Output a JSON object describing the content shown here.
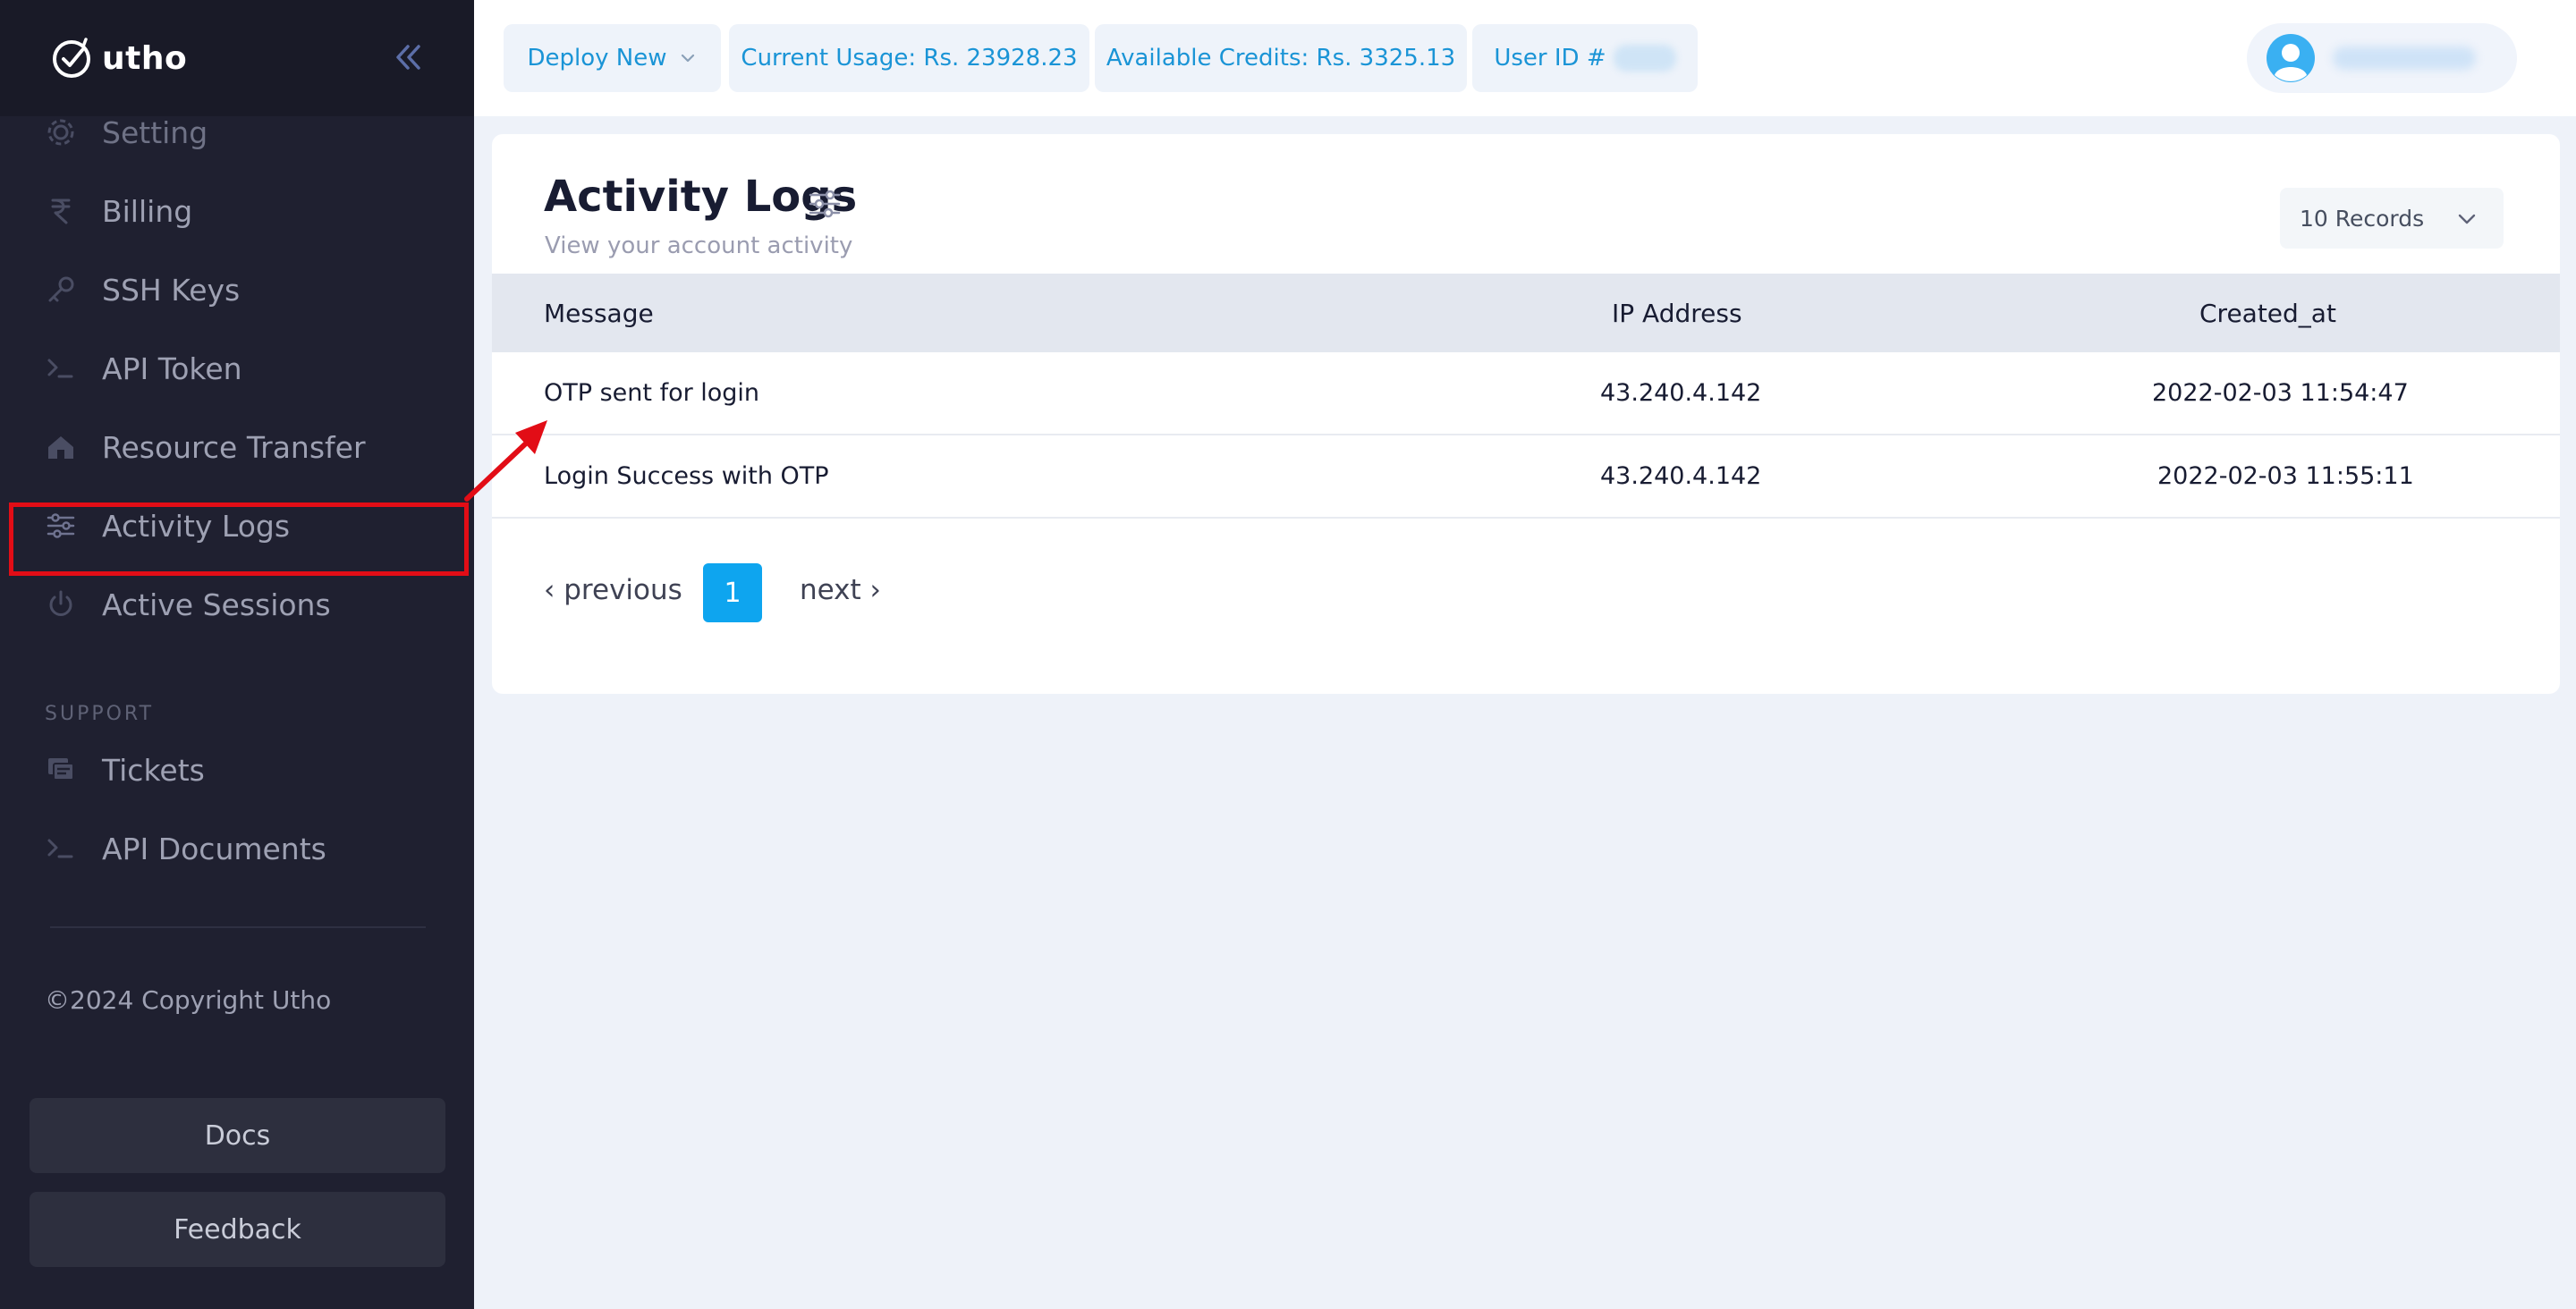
{
  "brand": {
    "name": "utho"
  },
  "sidebar": {
    "items": [
      {
        "label": "Setting",
        "icon": "gear-icon"
      },
      {
        "label": "Billing",
        "icon": "rupee-icon"
      },
      {
        "label": "SSH Keys",
        "icon": "key-icon"
      },
      {
        "label": "API Token",
        "icon": "terminal-icon"
      },
      {
        "label": "Resource Transfer",
        "icon": "transfer-icon"
      },
      {
        "label": "Activity Logs",
        "icon": "sliders-icon",
        "active": true
      },
      {
        "label": "Active Sessions",
        "icon": "power-icon"
      }
    ],
    "support_title": "SUPPORT",
    "support_items": [
      {
        "label": "Tickets",
        "icon": "ticket-icon"
      },
      {
        "label": "API Documents",
        "icon": "terminal-icon"
      }
    ],
    "copyright": "©2024 Copyright Utho",
    "docs_label": "Docs",
    "feedback_label": "Feedback"
  },
  "topbar": {
    "deploy_label": "Deploy New",
    "current_usage": "Current Usage: Rs. 23928.23",
    "available_credits": "Available Credits: Rs. 3325.13",
    "user_id_label": "User ID #"
  },
  "page": {
    "title": "Activity Logs",
    "subtitle": "View your account activity",
    "records_select": "10 Records"
  },
  "table": {
    "headers": [
      "Message",
      "IP Address",
      "Created_at"
    ],
    "rows": [
      [
        "OTP sent for login",
        "43.240.4.142",
        "2022-02-03 11:54:47"
      ],
      [
        "Login Success with OTP",
        "43.240.4.142",
        "2022-02-03 11:55:11"
      ]
    ]
  },
  "pagination": {
    "previous": "‹ previous",
    "current_page": "1",
    "next": "next ›"
  },
  "colors": {
    "sidebar_bg": "#1f2030",
    "accent": "#0ea5ef",
    "link": "#1a94d6",
    "highlight": "#e20d16",
    "content_bg": "#eef2f9"
  }
}
